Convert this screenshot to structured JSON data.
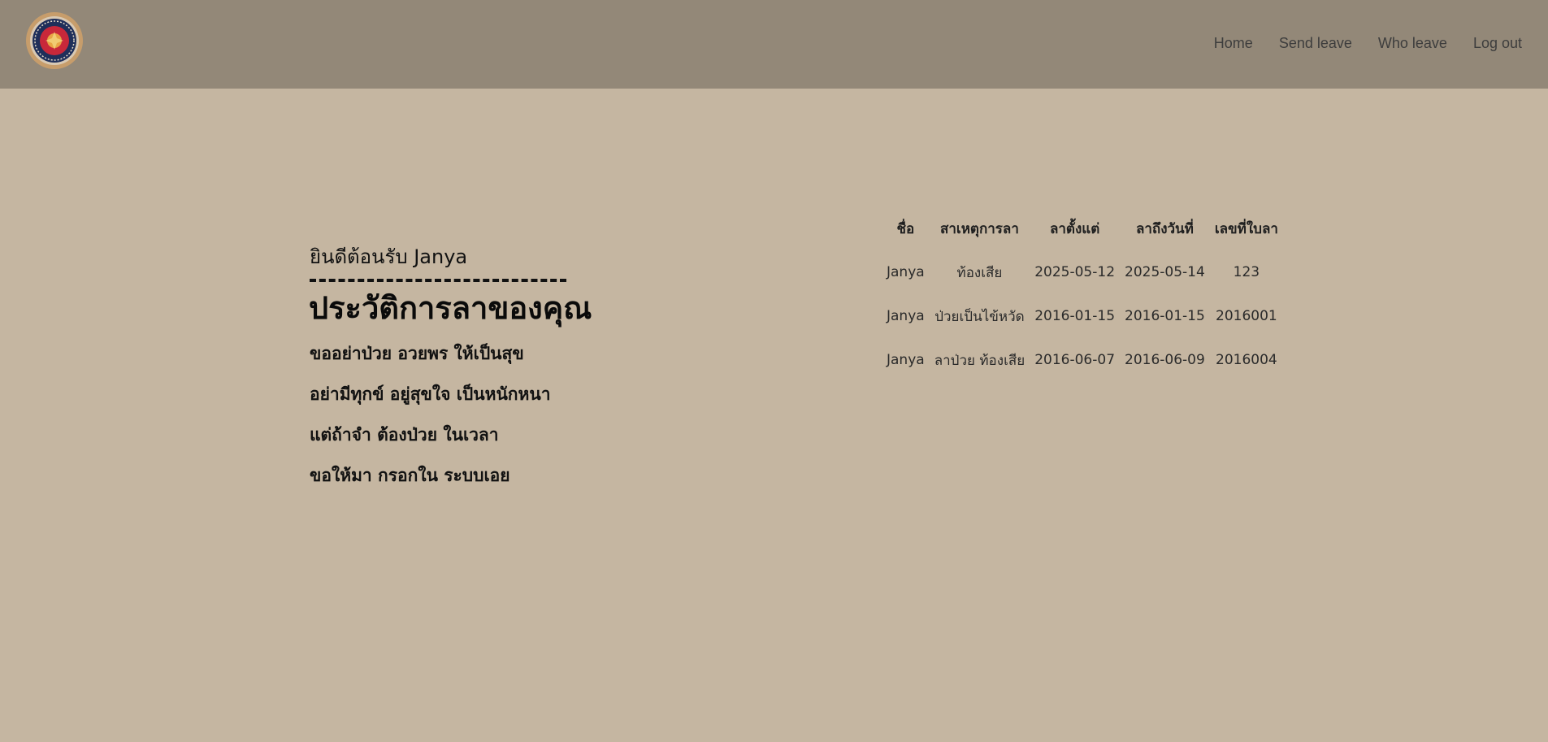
{
  "nav": {
    "links": [
      "Home",
      "Send leave",
      "Who leave",
      "Log out"
    ]
  },
  "welcome": "ยินดีต้อนรับ Janya",
  "title": "ประวัติการลาของคุณ",
  "poem": [
    "ขออย่าป่วย อวยพร ให้เป็นสุข",
    "อย่ามีทุกข์ อยู่สุขใจ เป็นหนักหนา",
    "แต่ถ้าจำ ต้องป่วย ในเวลา",
    "ขอให้มา กรอกใน ระบบเอย"
  ],
  "table": {
    "headers": [
      "ชื่อ",
      "สาเหตุการลา",
      "ลาตั้งแต่",
      "ลาถึงวันที่",
      "เลขที่ใบลา"
    ],
    "rows": [
      [
        "Janya",
        "ท้องเสีย",
        "2025-05-12",
        "2025-05-14",
        "123"
      ],
      [
        "Janya",
        "ป่วยเป็นไข้หวัด",
        "2016-01-15",
        "2016-01-15",
        "2016001"
      ],
      [
        "Janya",
        "ลาป่วย ท้องเสีย",
        "2016-06-07",
        "2016-06-09",
        "2016004"
      ]
    ]
  },
  "colors": {
    "navbar": "#938878",
    "background": "#c5b6a1",
    "nav_text": "#3d3d3d",
    "logo_ring": "#c79d6b",
    "logo_inner": "#1f2f5a",
    "logo_center": "#c8283a"
  },
  "icons": {
    "logo": "seal-emblem-icon"
  }
}
